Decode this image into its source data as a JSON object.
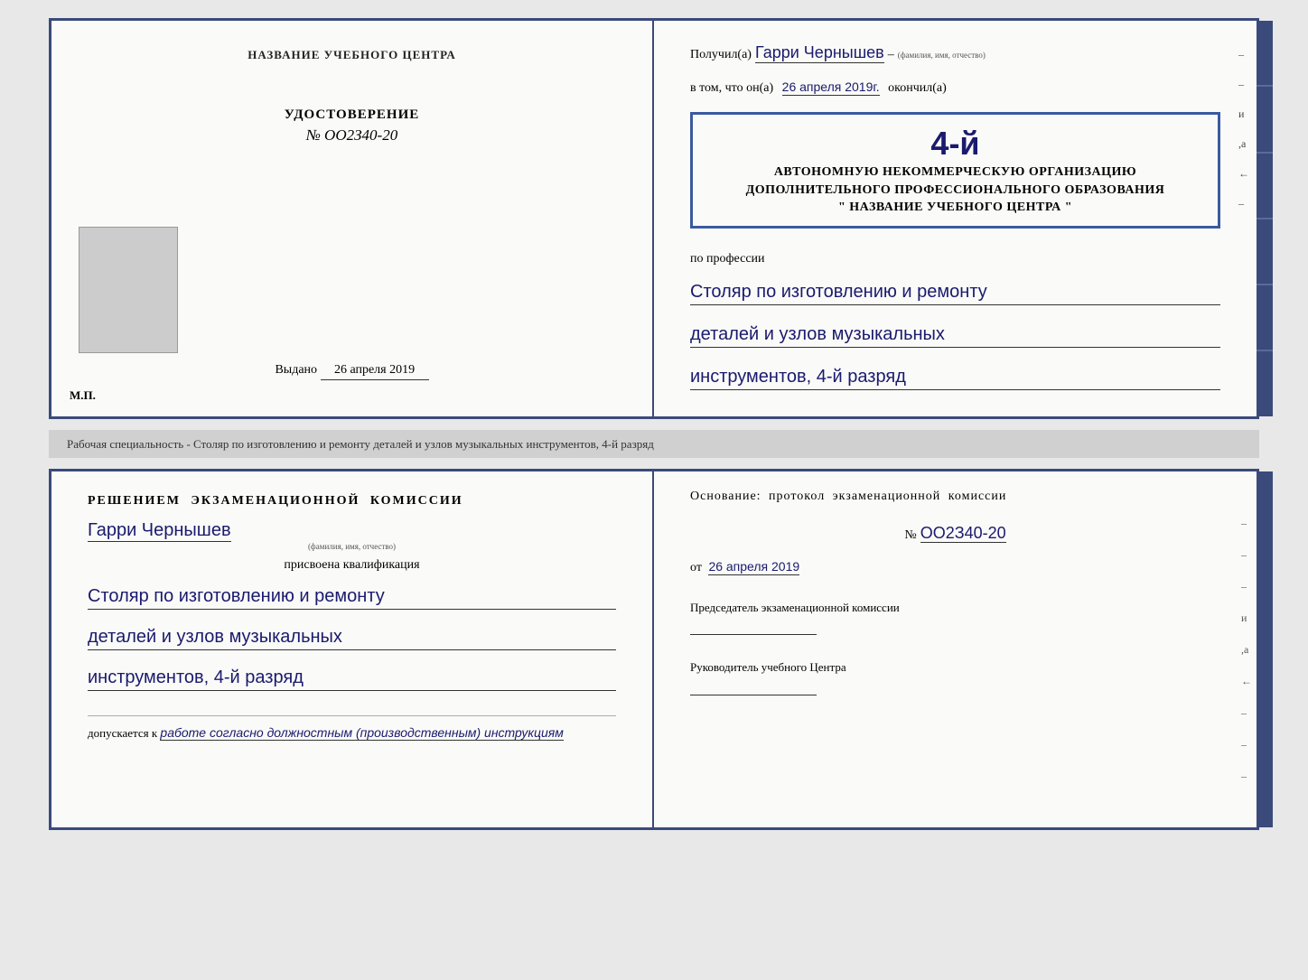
{
  "top_doc": {
    "left": {
      "section_title": "НАЗВАНИЕ УЧЕБНОГО ЦЕНТРА",
      "photo_placeholder": "",
      "udostoverenie_title": "УДОСТОВЕРЕНИЕ",
      "number": "№ OO2З40-20",
      "vidano_label": "Выдано",
      "vidano_date": "26 апреля 2019",
      "mp": "М.П."
    },
    "right": {
      "poluchil_label": "Получил(а)",
      "name_handwritten": "Гарри Чернышев",
      "fio_sublabel": "(фамилия, имя, отчество)",
      "dash1": "–",
      "vtom_label": "в том, что он(а)",
      "vtom_date": "26 апреля 2019г.",
      "okonchil_label": "окончил(а)",
      "stamp_number": "4-й",
      "stamp_line1": "АВТОНОМНУЮ НЕКОММЕРЧЕСКУЮ ОРГАНИЗАЦИЮ",
      "stamp_line2": "ДОПОЛНИТЕЛЬНОГО ПРОФЕССИОНАЛЬНОГО ОБРАЗОВАНИЯ",
      "stamp_line3": "\" НАЗВАНИЕ УЧЕБНОГО ЦЕНТРА \"",
      "po_professii": "по профессии",
      "profession_line1": "Столяр по изготовлению и ремонту",
      "profession_line2": "деталей и узлов музыкальных",
      "profession_line3": "инструментов, 4-й разряд",
      "side_marks": [
        "–",
        "и",
        ",а",
        "←",
        "–"
      ]
    }
  },
  "separator": {
    "text": "Рабочая специальность - Столяр по изготовлению и ремонту деталей и узлов музыкальных инструментов, 4-й разряд"
  },
  "bottom_doc": {
    "left": {
      "resheniem_text": "Решением экзаменационной комиссии",
      "name_handwritten": "Гарри Чернышев",
      "fio_sublabel": "(фамилия, имя, отчество)",
      "prisvoena_text": "присвоена квалификация",
      "qualification_line1": "Столяр по изготовлению и ремонту",
      "qualification_line2": "деталей и узлов музыкальных",
      "qualification_line3": "инструментов, 4-й разряд",
      "dopuskaetsya_label": "допускается к",
      "dopuskaetsya_text": "работе согласно должностным (производственным) инструкциям"
    },
    "right": {
      "osnovanie_text": "Основание: протокол экзаменационной комиссии",
      "number_label": "№",
      "number_value": "OO2З40-20",
      "ot_label": "от",
      "ot_date": "26 апреля 2019",
      "predsedatel_title": "Председатель экзаменационной комиссии",
      "rukovoditel_title": "Руководитель учебного Центра",
      "side_marks": [
        "–",
        "–",
        "–",
        "и",
        ",а",
        "←",
        "–",
        "–",
        "–"
      ]
    }
  }
}
